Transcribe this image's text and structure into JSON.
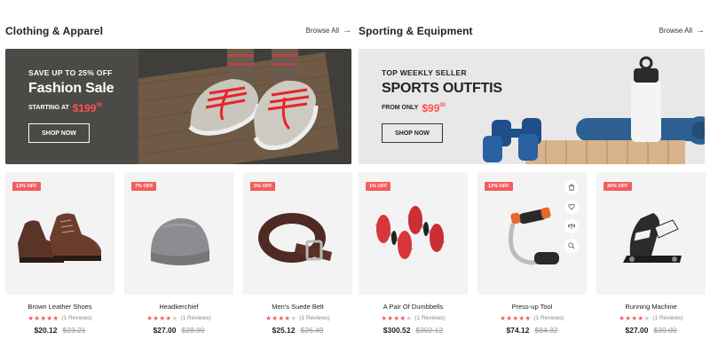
{
  "sections": [
    {
      "title": "Clothing & Apparel",
      "browse_label": "Browse All",
      "banner": {
        "kicker": "SAVE UP TO 25% OFF",
        "title": "Fashion Sale",
        "price_prefix": "STARTING AT",
        "price_main": "$199",
        "price_cents": "99",
        "button_label": "SHOP NOW"
      },
      "products": [
        {
          "badge": "13% OFF",
          "name": "Brown Leather Shoes",
          "reviews": "(1 Reviews)",
          "price": "$20.12",
          "old_price": "$23.21",
          "rating": 5
        },
        {
          "badge": "7% OFF",
          "name": "Headkerchief",
          "reviews": "(1 Reviews)",
          "price": "$27.00",
          "old_price": "$28.90",
          "rating": 4
        },
        {
          "badge": "5% OFF",
          "name": "Men's Suede Belt",
          "reviews": "(1 Reviews)",
          "price": "$25.12",
          "old_price": "$26.49",
          "rating": 4
        }
      ]
    },
    {
      "title": "Sporting & Equipment",
      "browse_label": "Browse All",
      "banner": {
        "kicker": "TOP WEEKLY SELLER",
        "title": "SPORTS OUTFTIS",
        "price_prefix": "FROM ONLY",
        "price_main": "$99",
        "price_cents": "00",
        "button_label": "SHOP NOW"
      },
      "products": [
        {
          "badge": "1% OFF",
          "name": "A Pair Of Dumbbells",
          "reviews": "(1 Reviews)",
          "price": "$300.52",
          "old_price": "$302.12",
          "rating": 4
        },
        {
          "badge": "12% OFF",
          "name": "Press-up Tool",
          "reviews": "(1 Reviews)",
          "price": "$74.12",
          "old_price": "$84.32",
          "rating": 5
        },
        {
          "badge": "30% OFF",
          "name": "Running Machine",
          "reviews": "(1 Reviews)",
          "price": "$27.00",
          "old_price": "$39.00",
          "rating": 4
        }
      ]
    }
  ],
  "hover_card_icons": [
    "bag-icon",
    "heart-icon",
    "compare-icon",
    "zoom-icon"
  ],
  "colors": {
    "accent": "#f35c5c",
    "banner_dark": "#4b4a46",
    "banner_light": "#e8e8e8",
    "card_bg": "#f3f3f3"
  }
}
